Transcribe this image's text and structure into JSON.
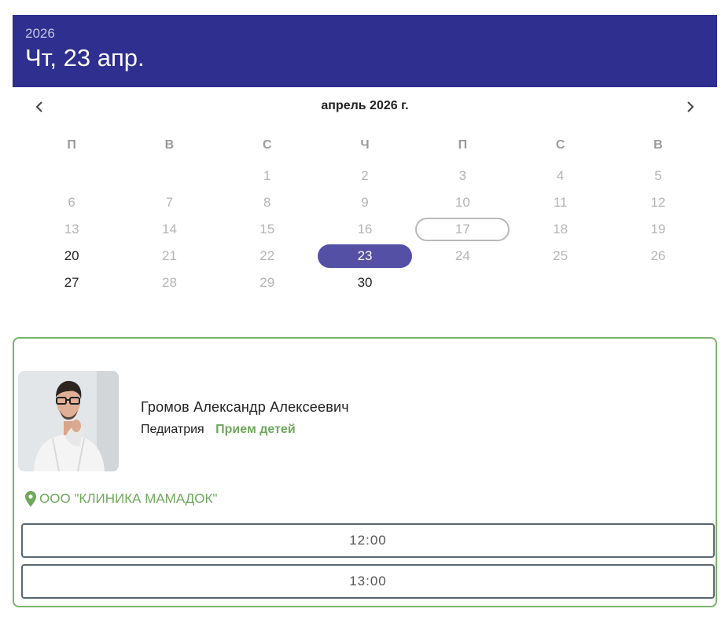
{
  "header": {
    "year": "2026",
    "date": "Чт, 23 апр."
  },
  "calendar": {
    "month_label": "апрель 2026 г.",
    "prev_icon": "chevron-left-icon",
    "next_icon": "chevron-right-icon",
    "weekdays": [
      "П",
      "В",
      "С",
      "Ч",
      "П",
      "С",
      "В"
    ],
    "leading_blank_days": 2,
    "days": [
      {
        "label": "1",
        "state": "disabled"
      },
      {
        "label": "2",
        "state": "disabled"
      },
      {
        "label": "3",
        "state": "disabled"
      },
      {
        "label": "4",
        "state": "disabled"
      },
      {
        "label": "5",
        "state": "disabled"
      },
      {
        "label": "6",
        "state": "disabled"
      },
      {
        "label": "7",
        "state": "disabled"
      },
      {
        "label": "8",
        "state": "disabled"
      },
      {
        "label": "9",
        "state": "disabled"
      },
      {
        "label": "10",
        "state": "disabled"
      },
      {
        "label": "11",
        "state": "disabled"
      },
      {
        "label": "12",
        "state": "disabled"
      },
      {
        "label": "13",
        "state": "disabled"
      },
      {
        "label": "14",
        "state": "disabled"
      },
      {
        "label": "15",
        "state": "disabled"
      },
      {
        "label": "16",
        "state": "disabled"
      },
      {
        "label": "17",
        "state": "today"
      },
      {
        "label": "18",
        "state": "disabled"
      },
      {
        "label": "19",
        "state": "disabled"
      },
      {
        "label": "20",
        "state": "available"
      },
      {
        "label": "21",
        "state": "disabled"
      },
      {
        "label": "22",
        "state": "disabled"
      },
      {
        "label": "23",
        "state": "selected"
      },
      {
        "label": "24",
        "state": "disabled"
      },
      {
        "label": "25",
        "state": "disabled"
      },
      {
        "label": "26",
        "state": "disabled"
      },
      {
        "label": "27",
        "state": "available"
      },
      {
        "label": "28",
        "state": "disabled"
      },
      {
        "label": "29",
        "state": "disabled"
      },
      {
        "label": "30",
        "state": "available"
      }
    ],
    "colors": {
      "header_bg": "#2e2f8f",
      "selected_bg": "#5350a6",
      "today_border": "#b9b9b9"
    }
  },
  "doctor": {
    "name": "Громов Александр Алексеевич",
    "specialty": "Педиатрия",
    "tag": "Прием детей",
    "clinic": "ООО \"КЛИНИКА МАМАДОК\"",
    "clinic_icon": "map-pin-icon",
    "accent_color": "#6fa85c",
    "slots": [
      "12:00",
      "13:00"
    ]
  }
}
